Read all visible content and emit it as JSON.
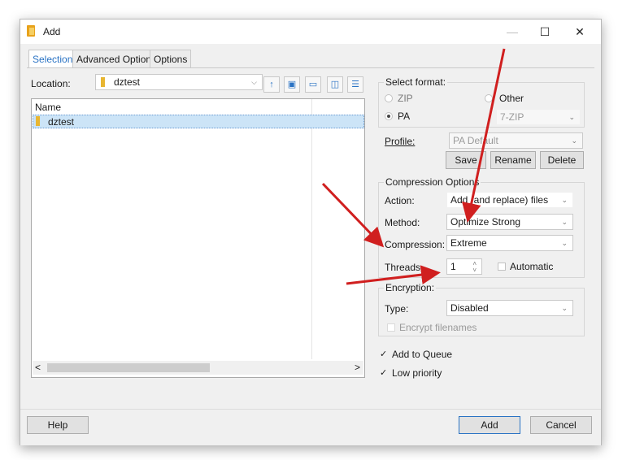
{
  "window": {
    "title": "Add",
    "minimize": "—",
    "maximize": "☐",
    "close": "✕"
  },
  "tabs": [
    {
      "label": "Selection"
    },
    {
      "label": "Advanced Options"
    },
    {
      "label": "Options"
    }
  ],
  "location": {
    "label": "Location:",
    "value": "dztest"
  },
  "list": {
    "column_name": "Name",
    "items": [
      "dztest"
    ]
  },
  "scroll": {
    "left": "<",
    "right": ">"
  },
  "format": {
    "group_title": "Select format:",
    "zip": "ZIP",
    "other": "Other",
    "pa": "PA",
    "other_value": "7-ZIP"
  },
  "profile": {
    "label": "Profile:",
    "value": "PA Default",
    "save": "Save",
    "rename": "Rename",
    "delete": "Delete"
  },
  "compression": {
    "group_title": "Compression Options",
    "action_label": "Action:",
    "action_value": "Add (and replace) files",
    "method_label": "Method:",
    "method_value": "Optimize Strong",
    "compression_label": "Compression:",
    "compression_value": "Extreme",
    "threads_label": "Threads",
    "threads_value": "1",
    "automatic": "Automatic"
  },
  "encryption": {
    "group_title": "Encryption:",
    "type_label": "Type:",
    "type_value": "Disabled",
    "encrypt_filenames": "Encrypt filenames"
  },
  "options": {
    "add_to_queue": "Add to Queue",
    "low_priority": "Low priority"
  },
  "footer": {
    "help": "Help",
    "add": "Add",
    "cancel": "Cancel"
  },
  "colors": {
    "accent": "#2a73c4",
    "annotation_arrow": "#d01f1f",
    "selection": "#cce4f7"
  }
}
